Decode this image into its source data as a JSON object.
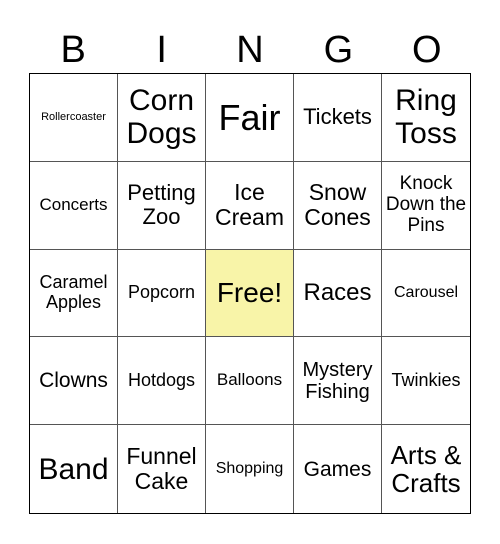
{
  "header": [
    "B",
    "I",
    "N",
    "G",
    "O"
  ],
  "free_color": "#f8f4a8",
  "cells": [
    {
      "text": "Rollercoaster",
      "size": 11
    },
    {
      "text": "Corn Dogs",
      "size": 30
    },
    {
      "text": "Fair",
      "size": 36
    },
    {
      "text": "Tickets",
      "size": 22
    },
    {
      "text": "Ring Toss",
      "size": 30
    },
    {
      "text": "Concerts",
      "size": 17
    },
    {
      "text": "Petting Zoo",
      "size": 22
    },
    {
      "text": "Ice Cream",
      "size": 23
    },
    {
      "text": "Snow Cones",
      "size": 23
    },
    {
      "text": "Knock Down the Pins",
      "size": 19
    },
    {
      "text": "Caramel Apples",
      "size": 18
    },
    {
      "text": "Popcorn",
      "size": 18
    },
    {
      "text": "Free!",
      "size": 28,
      "free": true
    },
    {
      "text": "Races",
      "size": 24
    },
    {
      "text": "Carousel",
      "size": 16
    },
    {
      "text": "Clowns",
      "size": 21
    },
    {
      "text": "Hotdogs",
      "size": 18
    },
    {
      "text": "Balloons",
      "size": 17
    },
    {
      "text": "Mystery Fishing",
      "size": 20
    },
    {
      "text": "Twinkies",
      "size": 18
    },
    {
      "text": "Band",
      "size": 30
    },
    {
      "text": "Funnel Cake",
      "size": 23
    },
    {
      "text": "Shopping",
      "size": 16
    },
    {
      "text": "Games",
      "size": 21
    },
    {
      "text": "Arts & Crafts",
      "size": 26
    }
  ]
}
